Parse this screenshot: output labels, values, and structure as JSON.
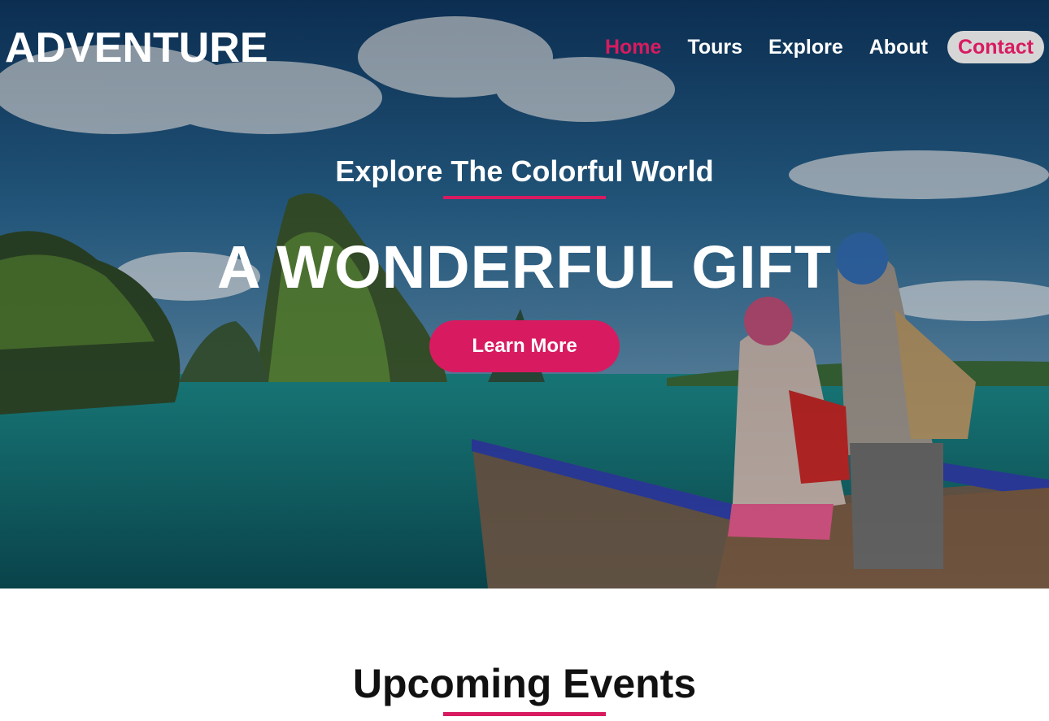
{
  "brand": {
    "name": "ADVENTURE"
  },
  "nav": {
    "items": [
      {
        "label": "Home",
        "state": "active"
      },
      {
        "label": "Tours",
        "state": "default"
      },
      {
        "label": "Explore",
        "state": "default"
      },
      {
        "label": "About",
        "state": "default"
      },
      {
        "label": "Contact",
        "state": "highlighted"
      }
    ]
  },
  "hero": {
    "subtitle": "Explore The Colorful World",
    "title": "A WONDERFUL GIFT",
    "cta_label": "Learn More",
    "image": "travelers-at-tropical-lagoon"
  },
  "events": {
    "title": "Upcoming Events"
  },
  "colors": {
    "accent": "#d81b60",
    "text_light": "#ffffff",
    "text_dark": "#111111",
    "pill_bg": "#d6d6d6"
  }
}
